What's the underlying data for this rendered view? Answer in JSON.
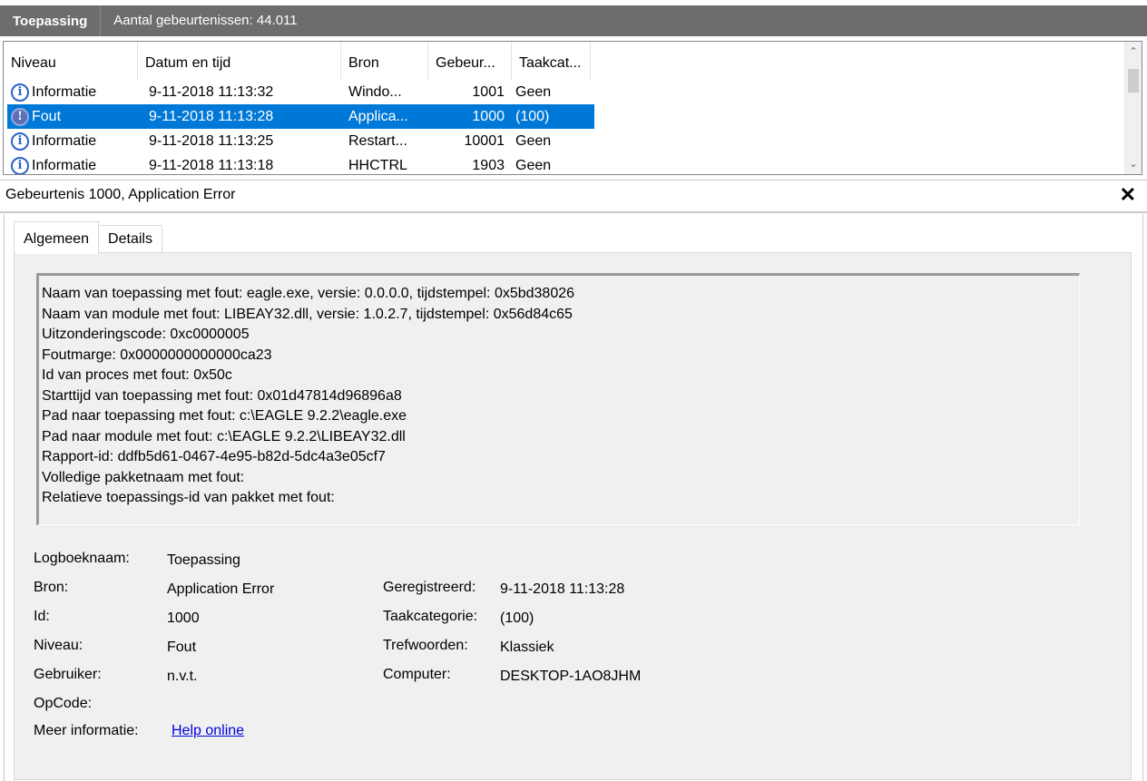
{
  "header": {
    "log_name": "Toepassing",
    "event_count": "Aantal gebeurtenissen: 44.011"
  },
  "columns": [
    "Niveau",
    "Datum en tijd",
    "Bron",
    "Gebeur...",
    "Taakcat..."
  ],
  "events": [
    {
      "level": "Informatie",
      "datetime": "9-11-2018 11:13:32",
      "source": "Windo...",
      "id": "1001",
      "task": "Geen",
      "icon": "info-icon",
      "selected": false
    },
    {
      "level": "Fout",
      "datetime": "9-11-2018 11:13:28",
      "source": "Applica...",
      "id": "1000",
      "task": "(100)",
      "icon": "error-icon",
      "selected": true
    },
    {
      "level": "Informatie",
      "datetime": "9-11-2018 11:13:25",
      "source": "Restart...",
      "id": "10001",
      "task": "Geen",
      "icon": "info-icon",
      "selected": false
    },
    {
      "level": "Informatie",
      "datetime": "9-11-2018 11:13:18",
      "source": "HHCTRL",
      "id": "1903",
      "task": "Geen",
      "icon": "info-icon",
      "selected": false
    }
  ],
  "details": {
    "title": "Gebeurtenis 1000, Application Error",
    "close": "✕",
    "tabs": {
      "general": "Algemeen",
      "details": "Details"
    },
    "description": [
      "Naam van toepassing met fout: eagle.exe, versie: 0.0.0.0, tijdstempel: 0x5bd38026",
      "Naam van module met fout: LIBEAY32.dll, versie: 1.0.2.7, tijdstempel: 0x56d84c65",
      "Uitzonderingscode: 0xc0000005",
      "Foutmarge: 0x0000000000000ca23",
      "Id van proces met fout: 0x50c",
      "Starttijd van toepassing met fout: 0x01d47814d96896a8",
      "Pad naar toepassing met fout: c:\\EAGLE 9.2.2\\eagle.exe",
      "Pad naar module met fout: c:\\EAGLE 9.2.2\\LIBEAY32.dll",
      "Rapport-id: ddfb5d61-0467-4e95-b82d-5dc4a3e05cf7",
      "Volledige pakketnaam met fout:",
      "Relatieve toepassings-id van pakket met fout:"
    ],
    "labels": {
      "log": "Logboeknaam:",
      "source": "Bron:",
      "id": "Id:",
      "level": "Niveau:",
      "user": "Gebruiker:",
      "opcode": "OpCode:",
      "more": "Meer informatie:",
      "logged": "Geregistreerd:",
      "task": "Taakcategorie:",
      "keywords": "Trefwoorden:",
      "computer": "Computer:"
    },
    "values": {
      "log": "Toepassing",
      "source": "Application Error",
      "id": "1000",
      "level": "Fout",
      "user": "n.v.t.",
      "more_link": "Help online",
      "logged": "9-11-2018 11:13:28",
      "task": "(100)",
      "keywords": "Klassiek",
      "computer": "DESKTOP-1AO8JHM"
    }
  }
}
